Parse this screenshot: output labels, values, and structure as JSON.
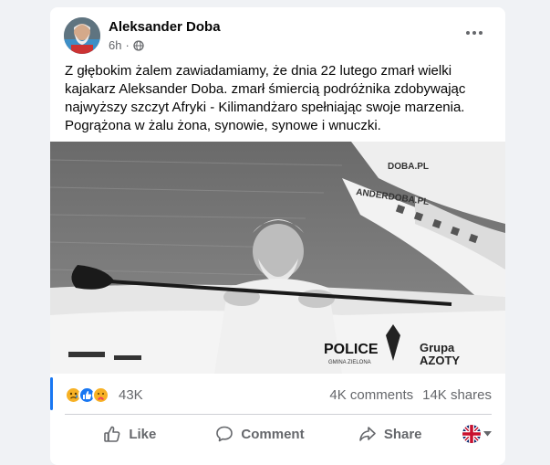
{
  "post": {
    "author": "Aleksander Doba",
    "time": "6h",
    "text": "Z głębokim żalem zawiadamiamy, że dnia 22 lutego zmarł wielki\nkajakarz Aleksander Doba. zmarł śmiercią podróżnika zdobywając\nnajwyższy szczyt Afryki - Kilimandżaro spełniając swoje marzenia.\nPogrążona w żalu żona, synowie, synowe i wnuczki.",
    "photo": {
      "hull_text_1": "DOBA.PL",
      "hull_text_2": "ANDERDOBA.PL",
      "sponsor_1": "POLICE",
      "sponsor_1_sub": "GMINA ZIELONA",
      "sponsor_2_line1": "Grupa",
      "sponsor_2_line2": "AZOTY"
    }
  },
  "reactions": {
    "icons": [
      "sad-reaction",
      "like-reaction",
      "care-reaction"
    ],
    "count": "43K"
  },
  "stats": {
    "comments": "4K comments",
    "shares": "14K shares"
  },
  "actions": {
    "like": "Like",
    "comment": "Comment",
    "share": "Share"
  },
  "colors": {
    "accent": "#1877f2",
    "secondary_text": "#65676b",
    "background": "#f0f2f5"
  }
}
